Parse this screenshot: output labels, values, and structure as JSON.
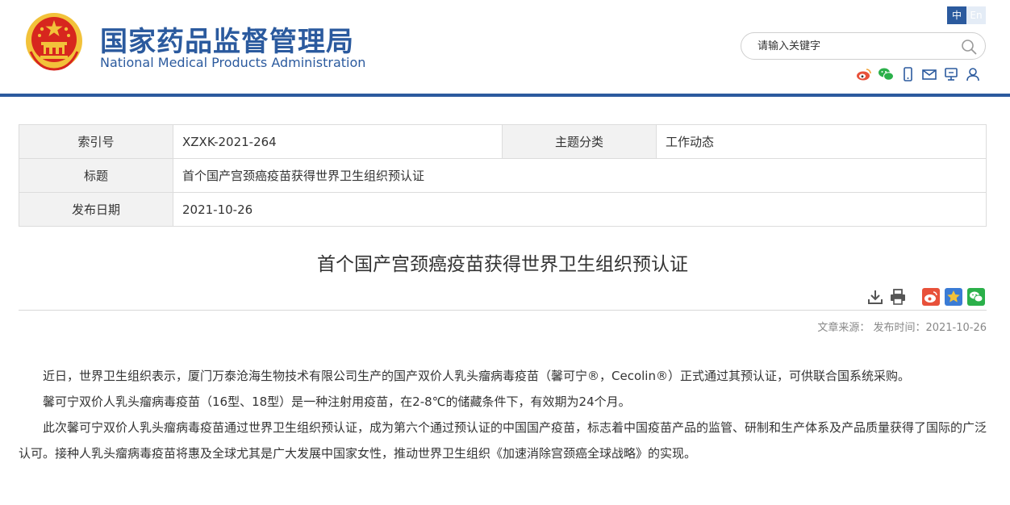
{
  "header": {
    "title_cn": "国家药品监督管理局",
    "title_en": "National Medical Products Administration",
    "lang_cn": "中",
    "lang_en": "En",
    "search_placeholder": "请输入关键字",
    "share_icons": [
      "weibo-icon",
      "wechat-icon",
      "mobile-icon",
      "mail-icon",
      "feedback-icon",
      "user-icon"
    ]
  },
  "info": {
    "index_label": "索引号",
    "index_value": "XZXK-2021-264",
    "category_label": "主题分类",
    "category_value": "工作动态",
    "title_label": "标题",
    "title_value": "首个国产宫颈癌疫苗获得世界卫生组织预认证",
    "date_label": "发布日期",
    "date_value": "2021-10-26"
  },
  "article": {
    "title": "首个国产宫颈癌疫苗获得世界卫生组织预认证",
    "meta": "文章来源： 发布时间：2021-10-26",
    "paragraphs": [
      "近日，世界卫生组织表示，厦门万泰沧海生物技术有限公司生产的国产双价人乳头瘤病毒疫苗（馨可宁®，Cecolin®）正式通过其预认证，可供联合国系统采购。",
      "馨可宁双价人乳头瘤病毒疫苗（16型、18型）是一种注射用疫苗，在2-8℃的储藏条件下，有效期为24个月。",
      "此次馨可宁双价人乳头瘤病毒疫苗通过世界卫生组织预认证，成为第六个通过预认证的中国国产疫苗，标志着中国疫苗产品的监管、研制和生产体系及产品质量获得了国际的广泛认可。接种人乳头瘤病毒疫苗将惠及全球尤其是广大发展中国家女性，推动世界卫生组织《加速消除宫颈癌全球战略》的实现。"
    ]
  },
  "colors": {
    "brand_blue": "#2b5a9e",
    "emblem_red": "#d7261e",
    "emblem_gold": "#f2c23a",
    "weibo_orange": "#e8513a",
    "star_blue": "#3a7bd5",
    "wechat_green": "#2bb04a"
  }
}
